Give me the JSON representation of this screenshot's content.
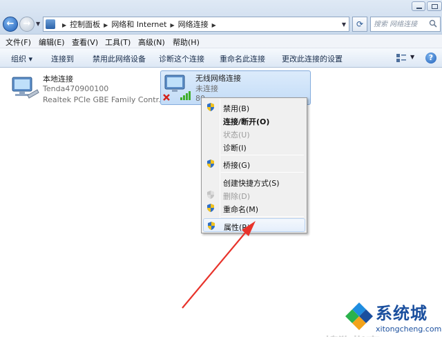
{
  "window": {
    "controls": {
      "minimize": "minimize",
      "maximize": "maximize"
    }
  },
  "nav": {
    "back": "back",
    "forward": "forward"
  },
  "address": {
    "crumbs": [
      "控制面板",
      "网络和 Internet",
      "网络连接"
    ]
  },
  "search": {
    "placeholder": "搜索 网络连接"
  },
  "menu": {
    "items": [
      "文件(F)",
      "编辑(E)",
      "查看(V)",
      "工具(T)",
      "高级(N)",
      "帮助(H)"
    ]
  },
  "toolbar": {
    "items": [
      "组织 ▾",
      "连接到",
      "禁用此网络设备",
      "诊断这个连接",
      "重命名此连接",
      "更改此连接的设置"
    ]
  },
  "connections": [
    {
      "name": "本地连接",
      "status": "Tenda470900100",
      "adapter": "Realtek PCIe GBE Family Contr..."
    },
    {
      "name": "无线网络连接",
      "status": "未连接",
      "adapter": "80"
    }
  ],
  "context_menu": {
    "items": [
      {
        "label": "禁用(B)",
        "icon": "shield-icon"
      },
      {
        "label": "连接/断开(O)",
        "icon": ""
      },
      {
        "label": "状态(U)",
        "icon": ""
      },
      {
        "label": "诊断(I)",
        "icon": ""
      },
      {
        "label": "桥接(G)",
        "icon": "shield-icon"
      },
      {
        "label": "创建快捷方式(S)",
        "icon": ""
      },
      {
        "label": "删除(D)",
        "icon": "shield-icon"
      },
      {
        "label": "重命名(M)",
        "icon": "shield-icon"
      },
      {
        "label": "属性(R)",
        "icon": "shield-icon"
      }
    ]
  },
  "watermark": {
    "text": "搜狗指南"
  },
  "brand": {
    "title": "系统城",
    "url": "xitongcheng.com"
  },
  "colors": {
    "accent": "#1f5fb9",
    "selection": "#c3dcf7",
    "arrow": "#e8332b",
    "brand": "#1a4f9e"
  }
}
